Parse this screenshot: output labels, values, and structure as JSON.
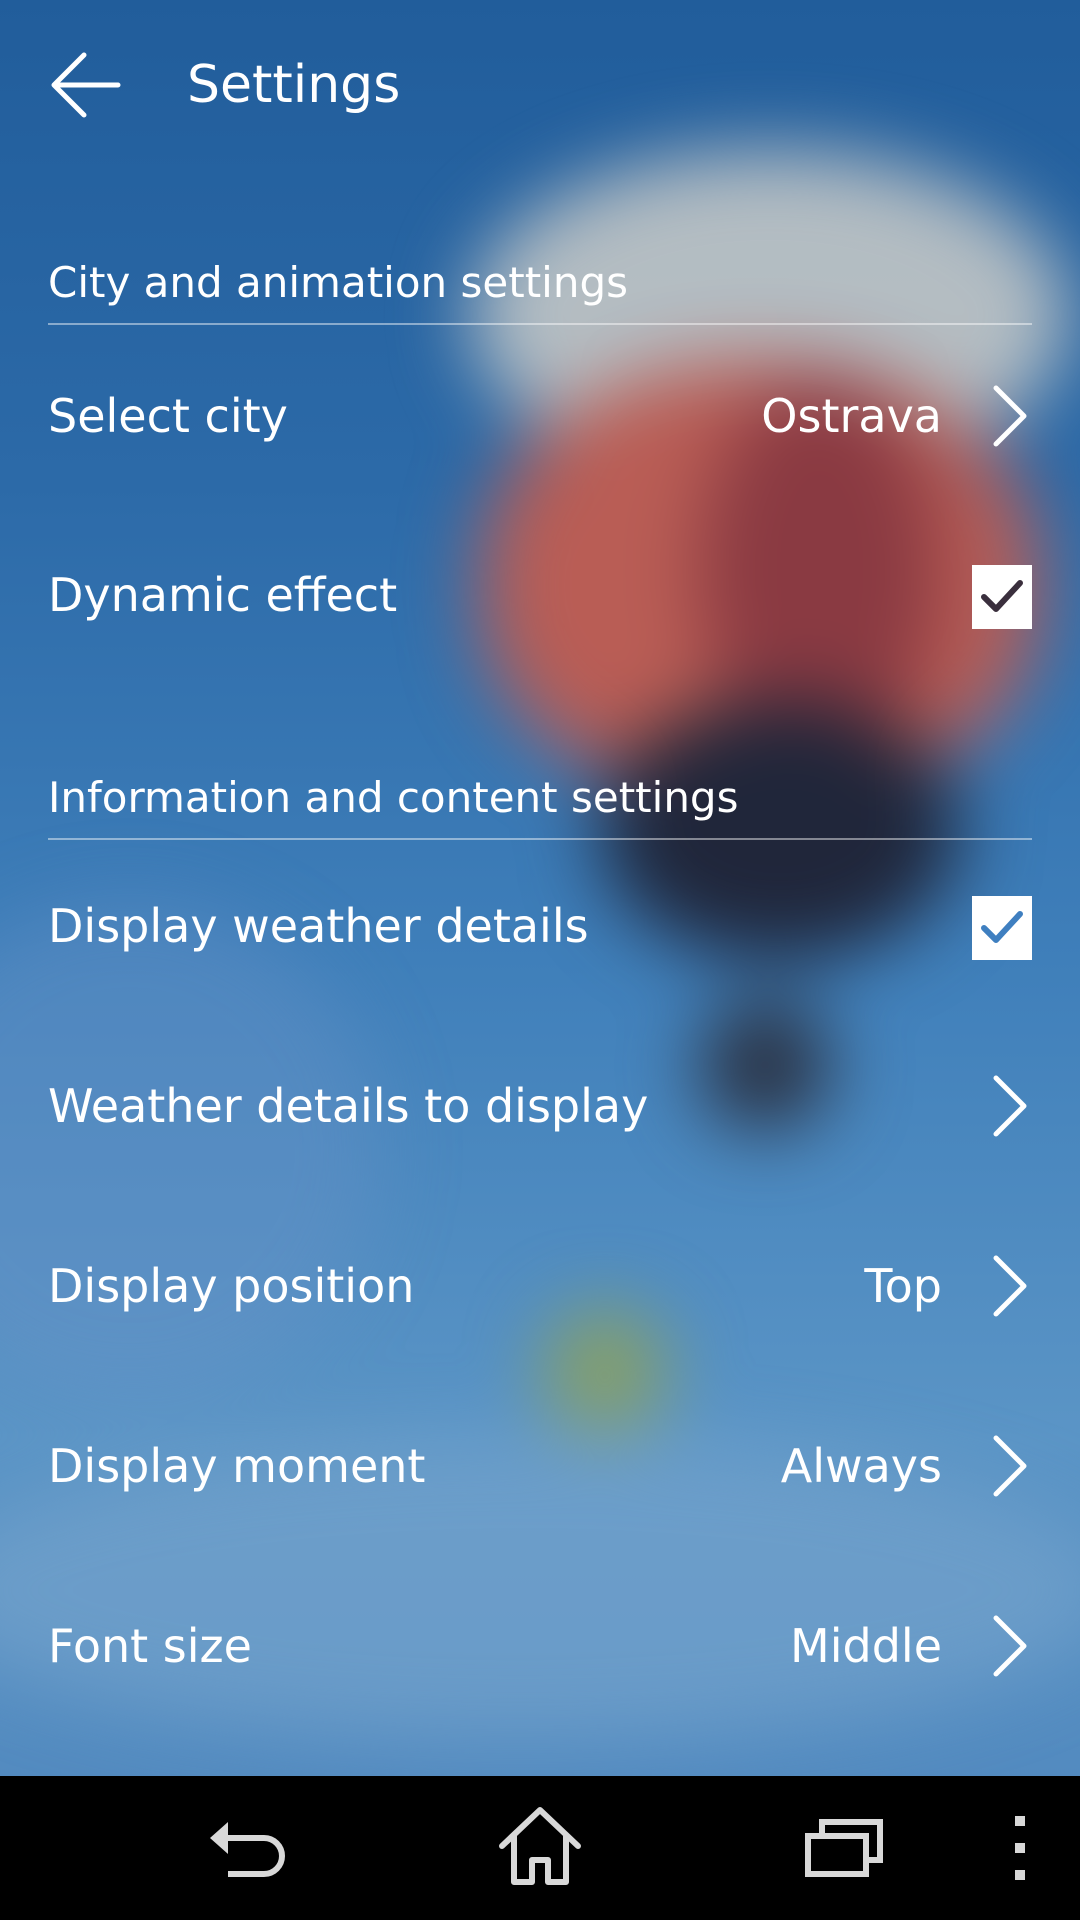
{
  "header": {
    "title": "Settings",
    "back_icon": "arrow-left-icon"
  },
  "sections": [
    {
      "title": "City and animation settings",
      "items": [
        {
          "label": "Select city",
          "value": "Ostrava",
          "control": "chevron-right-icon"
        },
        {
          "label": "Dynamic effect",
          "control": "checkbox",
          "checked": true,
          "check_color": "#3a2f3d"
        }
      ]
    },
    {
      "title": "Information and content settings",
      "items": [
        {
          "label": "Display weather details",
          "control": "checkbox",
          "checked": true,
          "check_color": "#3f7fc0"
        },
        {
          "label": "Weather details to display",
          "value": "",
          "control": "chevron-right-icon"
        },
        {
          "label": "Display position",
          "value": "Top",
          "control": "chevron-right-icon"
        },
        {
          "label": "Display moment",
          "value": "Always",
          "control": "chevron-right-icon"
        },
        {
          "label": "Font size",
          "value": "Middle",
          "control": "chevron-right-icon"
        }
      ]
    }
  ],
  "navigation_bar": {
    "buttons": [
      "back-icon",
      "home-icon",
      "recent-apps-icon",
      "overflow-menu-icon"
    ]
  },
  "colors": {
    "text": "#ffffff",
    "nav_background": "#000000",
    "checkbox_background": "#ffffff"
  }
}
